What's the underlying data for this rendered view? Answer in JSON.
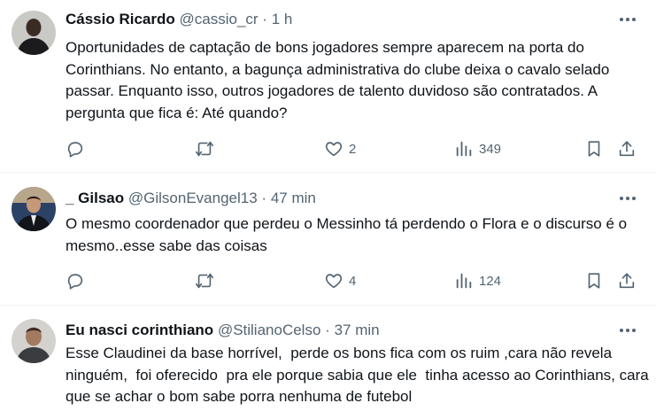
{
  "tweets": [
    {
      "author_name": "Cássio Ricardo",
      "handle": "@cassio_cr",
      "separator": "·",
      "time": "1 h",
      "text": "Oportunidades de captação de bons jogadores sempre aparecem na porta do Corinthians. No entanto, a bagunça administrativa do clube deixa o cavalo selado passar. Enquanto isso, outros jogadores de talento duvidoso são contratados. A pergunta que fica é: Até quando?",
      "likes": "2",
      "views": "349"
    },
    {
      "author_name": "_ Gilsao",
      "handle": "@GilsonEvangel13",
      "separator": "·",
      "time": "47 min",
      "text": "O mesmo coordenador que perdeu o Messinho tá perdendo o Flora e o discurso é o mesmo..esse sabe das coisas",
      "likes": "4",
      "views": "124"
    },
    {
      "author_name": "Eu nasci corinthiano",
      "handle": "@StilianoCelso",
      "separator": "·",
      "time": "37 min",
      "text": "Esse Claudinei da base horrível,  perde os bons fica com os ruim ,cara não revela ninguém,  foi oferecido  pra ele porque sabia que ele  tinha acesso ao Corinthians, cara que se achar o bom sabe porra nenhuma de futebol"
    }
  ],
  "icons": {
    "reply": "reply-icon",
    "retweet": "retweet-icon",
    "like": "heart-icon",
    "views": "views-icon",
    "bookmark": "bookmark-icon",
    "share": "share-icon",
    "more": "more-icon"
  },
  "colors": {
    "text": "#0f1419",
    "secondary": "#536471",
    "divider": "#eff3f4"
  }
}
